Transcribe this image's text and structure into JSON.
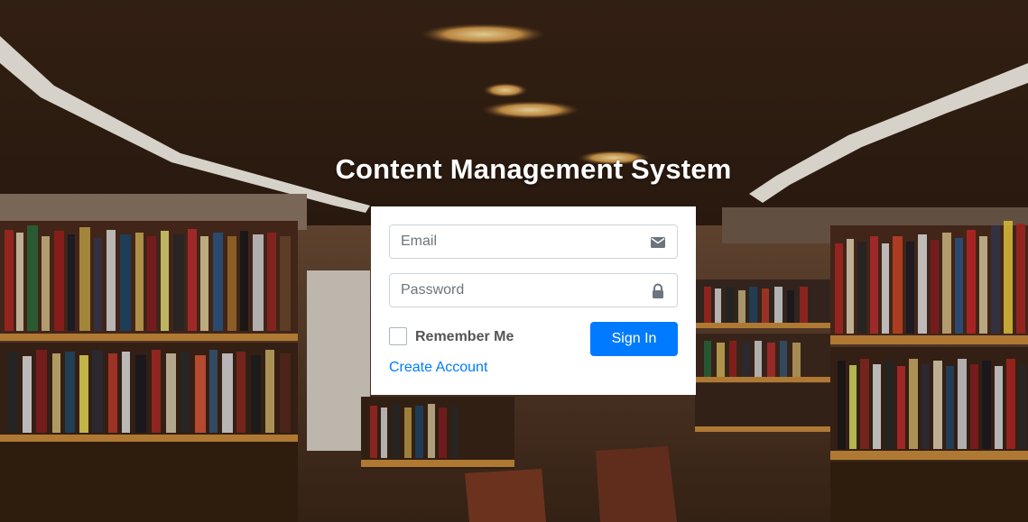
{
  "page": {
    "title": "Content Management System"
  },
  "login": {
    "email_placeholder": "Email",
    "email_value": "",
    "password_placeholder": "Password",
    "password_value": "",
    "remember_label": "Remember Me",
    "remember_checked": false,
    "signin_label": "Sign In",
    "create_account_label": "Create Account",
    "email_icon": "envelope-icon",
    "password_icon": "lock-icon"
  },
  "colors": {
    "accent": "#007bff",
    "card_bg": "#ffffff",
    "title_text": "#ffffff"
  }
}
